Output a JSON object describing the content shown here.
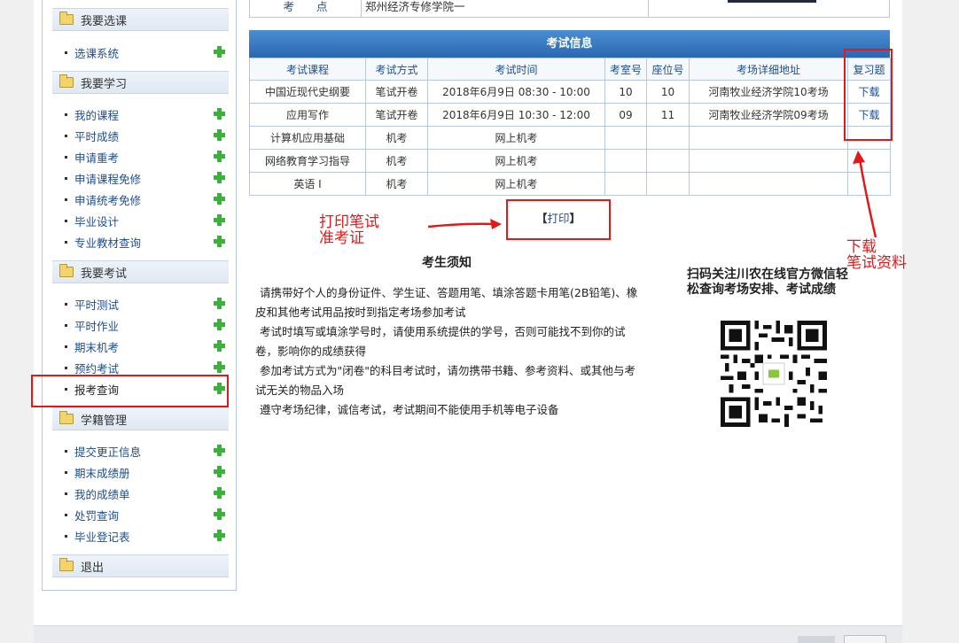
{
  "sidebar": {
    "sections": [
      {
        "title": "我要选课",
        "items": [
          {
            "label": "选课系统"
          }
        ]
      },
      {
        "title": "我要学习",
        "items": [
          {
            "label": "我的课程"
          },
          {
            "label": "平时成绩"
          },
          {
            "label": "申请重考"
          },
          {
            "label": "申请课程免修"
          },
          {
            "label": "申请统考免修"
          },
          {
            "label": "毕业设计"
          },
          {
            "label": "专业教材查询"
          }
        ]
      },
      {
        "title": "我要考试",
        "items": [
          {
            "label": "平时测试"
          },
          {
            "label": "平时作业"
          },
          {
            "label": "期末机考"
          },
          {
            "label": "预约考试"
          },
          {
            "label": "报考查询"
          }
        ]
      },
      {
        "title": "学籍管理",
        "items": [
          {
            "label": "提交更正信息"
          },
          {
            "label": "期末成绩册"
          },
          {
            "label": "我的成绩单"
          },
          {
            "label": "处罚查询"
          },
          {
            "label": "毕业登记表"
          }
        ]
      },
      {
        "title": "退出",
        "items": []
      }
    ]
  },
  "top_row": {
    "label": "考　　点",
    "value": "郑州经济专修学院一"
  },
  "exam": {
    "title": "考试信息",
    "headers": [
      "考试课程",
      "考试方式",
      "考试时间",
      "考室号",
      "座位号",
      "考场详细地址",
      "复习题"
    ],
    "rows": [
      [
        "中国近现代史纲要",
        "笔试开卷",
        "2018年6月9日 08:30 - 10:00",
        "10",
        "10",
        "河南牧业经济学院10考场",
        "下载"
      ],
      [
        "应用写作",
        "笔试开卷",
        "2018年6月9日 10:30 - 12:00",
        "09",
        "11",
        "河南牧业经济学院09考场",
        "下载"
      ],
      [
        "计算机应用基础",
        "机考",
        "网上机考",
        "",
        "",
        "",
        ""
      ],
      [
        "网络教育学习指导",
        "机考",
        "网上机考",
        "",
        "",
        "",
        ""
      ],
      [
        "英语 I",
        "机考",
        "网上机考",
        "",
        "",
        "",
        ""
      ]
    ]
  },
  "print": {
    "bracket_left": "【",
    "label": "打印",
    "bracket_right": "】"
  },
  "annotations": {
    "print_line1": "打印笔试",
    "print_line2": "准考证",
    "download_line1": "下载",
    "download_line2": "笔试资料"
  },
  "notice": {
    "title": "考生须知",
    "lines": [
      "请携带好个人的身份证件、学生证、答题用笔、填涂答题卡用笔(2B铅笔)、橡皮和其他考试用品按时到指定考场参加考试",
      "考试时填写或填涂学号时，请使用系统提供的学号，否则可能找不到你的试卷，影响你的成绩获得",
      "参加考试方式为\"闭卷\"的科目考试时，请勿携带书籍、参考资料、或其他与考试无关的物品入场",
      "遵守考场纪律，诚信考试，考试期间不能使用手机等电子设备"
    ]
  },
  "qr": {
    "text": "扫码关注川农在线官方微信轻松查询考场安排、考试成绩"
  },
  "colors": {
    "accent": "#2a67b1",
    "annotation": "#e01a1a",
    "link": "#1d4d8c",
    "plus": "#3bb03b"
  }
}
